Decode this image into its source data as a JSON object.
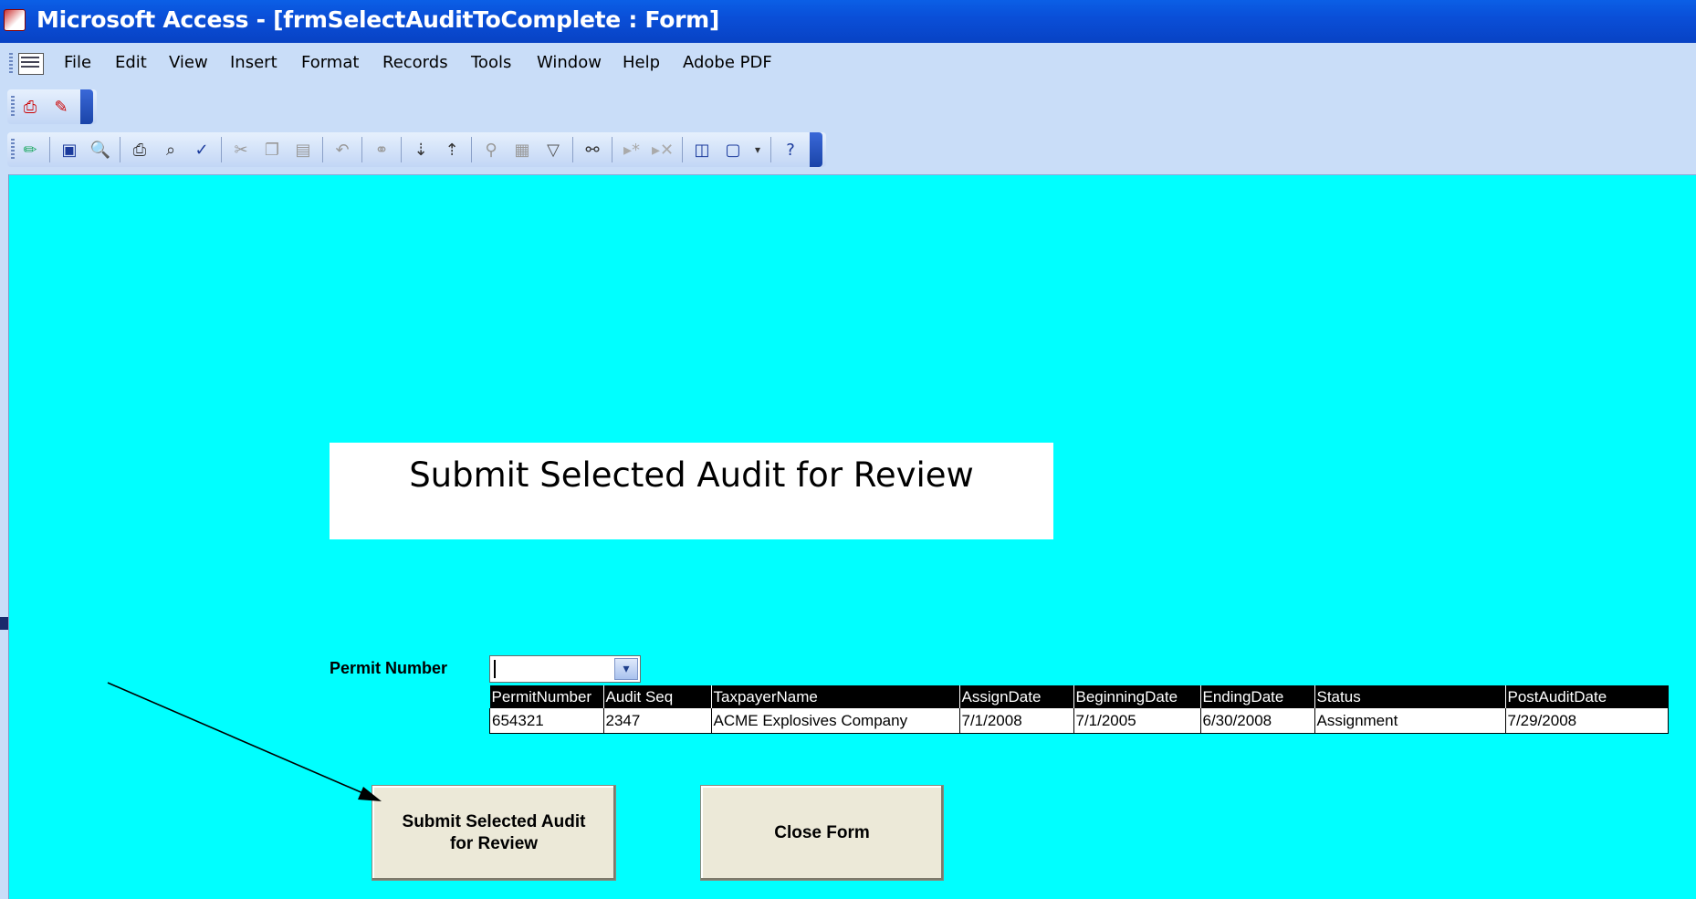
{
  "window": {
    "title": "Microsoft Access - [frmSelectAuditToComplete : Form]"
  },
  "menu": {
    "items": [
      "File",
      "Edit",
      "View",
      "Insert",
      "Format",
      "Records",
      "Tools",
      "Window",
      "Help",
      "Adobe PDF"
    ]
  },
  "toolbar1": {
    "icons": [
      "pdf-convert-icon",
      "pdf-convert-review-icon"
    ]
  },
  "toolbar2": {
    "icons": [
      "design-view-icon",
      "save-icon",
      "file-search-icon",
      "print-icon",
      "print-preview-icon",
      "spelling-icon",
      "cut-icon",
      "copy-icon",
      "paste-icon",
      "undo-icon",
      "insert-hyperlink-icon",
      "sort-ascending-icon",
      "sort-descending-icon",
      "filter-by-selection-icon",
      "filter-by-form-icon",
      "apply-filter-icon",
      "find-icon",
      "new-record-icon",
      "delete-record-icon",
      "database-window-icon",
      "new-object-icon",
      "help-icon"
    ]
  },
  "form": {
    "header": "Submit Selected Audit for Review",
    "permit_label": "Permit Number",
    "permit_value": "",
    "grid": {
      "columns": [
        "PermitNumber",
        "Audit Seq",
        "TaxpayerName",
        "AssignDate",
        "BeginningDate",
        "EndingDate",
        "Status",
        "PostAuditDate"
      ],
      "rows": [
        [
          "654321",
          "2347",
          "ACME Explosives Company",
          "7/1/2008",
          "7/1/2005",
          "6/30/2008",
          "Assignment",
          "7/29/2008"
        ]
      ]
    },
    "submit_label": "Submit Selected Audit for Review",
    "close_label": "Close Form"
  }
}
